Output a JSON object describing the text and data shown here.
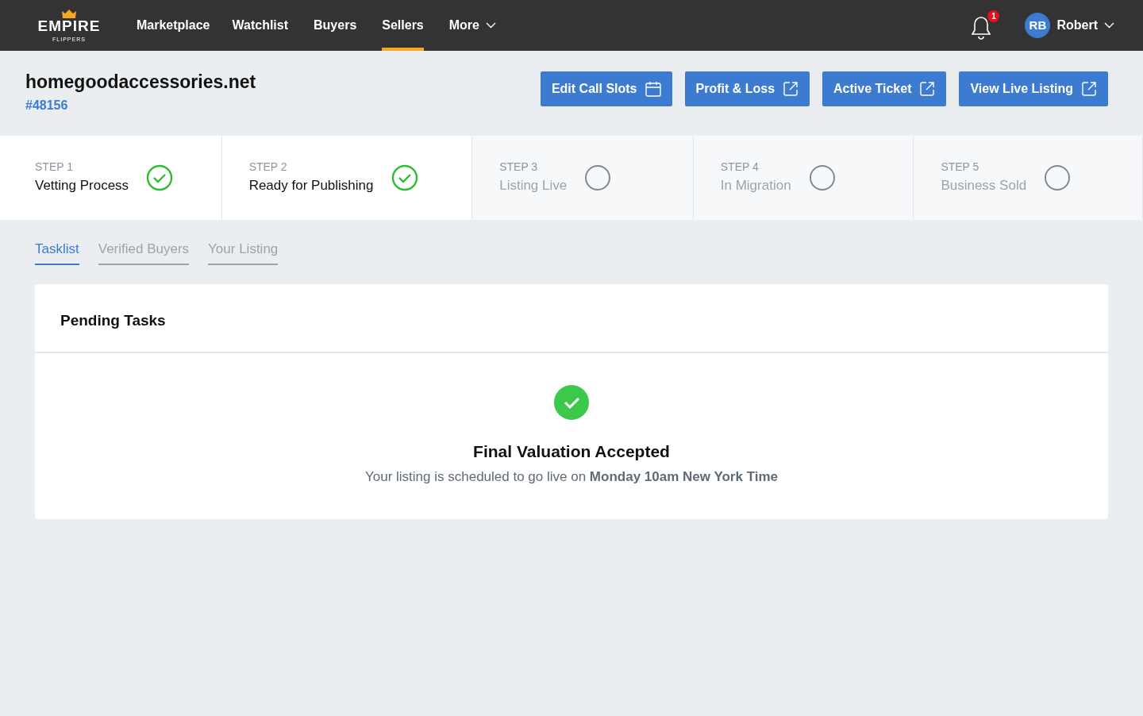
{
  "navbar": {
    "logo": {
      "word": "EMPIRE",
      "subword": "FLIPPERS"
    },
    "links": [
      {
        "label": "Marketplace",
        "selected": false,
        "dropdown": false
      },
      {
        "label": "Watchlist",
        "selected": false,
        "dropdown": false
      },
      {
        "label": "Buyers",
        "selected": false,
        "dropdown": false
      },
      {
        "label": "Sellers",
        "selected": true,
        "dropdown": false
      },
      {
        "label": "More",
        "selected": false,
        "dropdown": true
      }
    ],
    "notifications": "1",
    "user": {
      "initials": "RB",
      "name": "Robert"
    }
  },
  "listing": {
    "domain": "homegoodaccessories.net",
    "id": "#48156"
  },
  "actions": [
    {
      "label": "Edit Call Slots",
      "kind": "calendar"
    },
    {
      "label": "Profit & Loss",
      "kind": "external"
    },
    {
      "label": "Active Ticket",
      "kind": "external"
    },
    {
      "label": "View Live Listing",
      "kind": "external"
    }
  ],
  "steps": [
    {
      "step": "STEP 1",
      "label": "Vetting Process",
      "done": true
    },
    {
      "step": "STEP 2",
      "label": "Ready for Publishing",
      "done": true
    },
    {
      "step": "STEP 3",
      "label": "Listing Live",
      "done": false
    },
    {
      "step": "STEP 4",
      "label": "In Migration",
      "done": false
    },
    {
      "step": "STEP 5",
      "label": "Business Sold",
      "done": false
    }
  ],
  "tabs": [
    {
      "label": "Tasklist",
      "selected": true
    },
    {
      "label": "Verified Buyers",
      "selected": false
    },
    {
      "label": "Your Listing",
      "selected": false
    }
  ],
  "panel": {
    "title": "Pending Tasks",
    "status": {
      "title": "Final Valuation Accepted",
      "message": "Your listing is scheduled to go live on **Monday 10am New York Time**"
    }
  }
}
